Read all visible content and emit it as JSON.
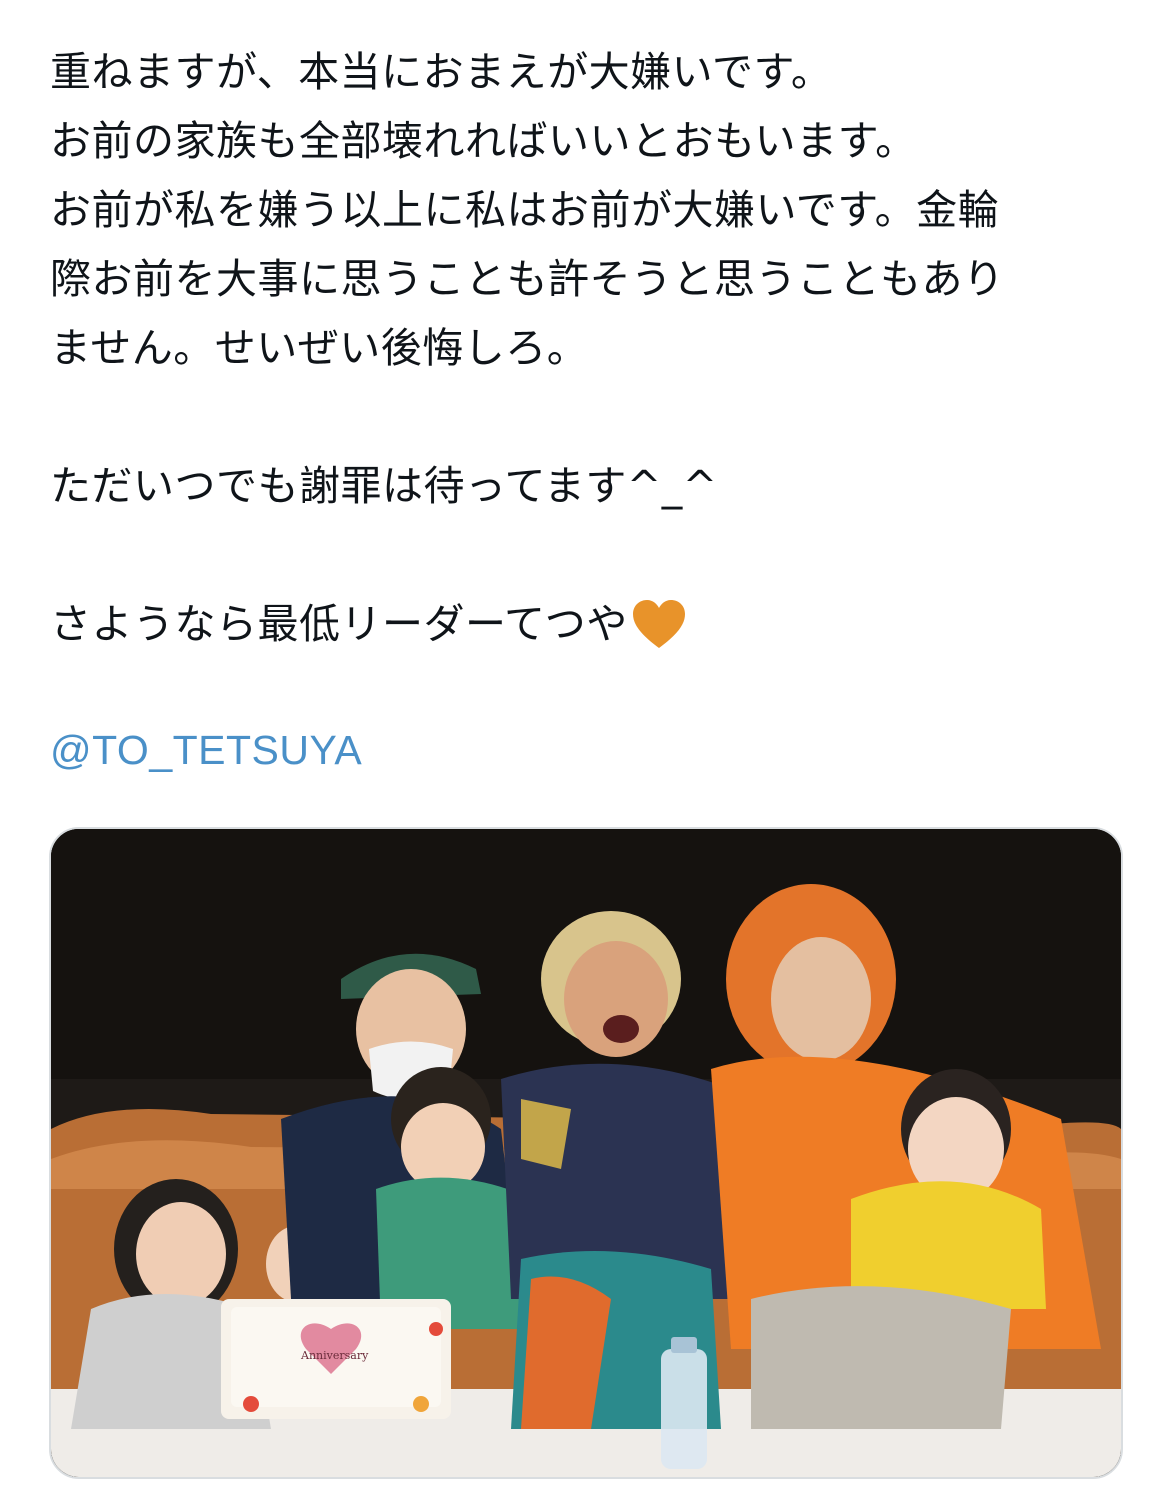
{
  "tweet": {
    "lines": [
      "重ねますが、本当におまえが大嫌いです。",
      "お前の家族も全部壊れればいいとおもいます。",
      "お前が私を嫌う以上に私はお前が大嫌いです。金輪",
      "際お前を大事に思うことも許そうと思うこともあり",
      "ません。せいぜい後悔しろ。"
    ],
    "line_wait": "ただいつでも謝罪は待ってます^_^",
    "line_bye": "さようなら最低リーダーてつや",
    "heart_icon": "orange-heart-icon",
    "heart_color": "#e8932a",
    "mention": "@TO_TETSUYA",
    "mention_color": "#4a90c8"
  },
  "media": {
    "type": "photo",
    "cake_text": "Anniversary"
  }
}
